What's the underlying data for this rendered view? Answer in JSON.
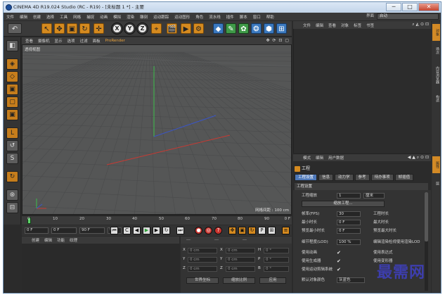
{
  "window": {
    "title": "CINEMA 4D R19.024 Studio (RC - R19) - [未标题 1 *] - 主要",
    "minimize": "─",
    "maximize": "□",
    "close": "✕"
  },
  "menubar": {
    "items": [
      "文件",
      "编辑",
      "创建",
      "选择",
      "工具",
      "网格",
      "捕捉",
      "动画",
      "模拟",
      "渲染",
      "雕刻",
      "运动跟踪",
      "运动图形",
      "角色",
      "流水线",
      "插件",
      "脚本",
      "窗口",
      "帮助"
    ],
    "layout_label": "界面",
    "layout_value": "启动"
  },
  "toolbar": {
    "undo": "↶",
    "tools": [
      "↖",
      "✥",
      "▣",
      "↻",
      "✛"
    ],
    "axes": [
      "X",
      "Y",
      "Z"
    ],
    "coord": "⌖",
    "render": [
      "🎬",
      "▶",
      "⚙"
    ],
    "create": [
      "◆",
      "✎",
      "✿",
      "❂",
      "⬢",
      "⊞"
    ]
  },
  "left_tools": [
    "◧",
    "◈",
    "◇",
    "▣",
    "▢",
    "▣",
    "L",
    "↺",
    "S",
    "↻",
    "⊛",
    "⊟"
  ],
  "viewport": {
    "menu": [
      "查看",
      "摄像机",
      "显示",
      "选项",
      "过滤",
      "面板"
    ],
    "render_menu": "ProRender",
    "label": "透视视图",
    "grid_spacing": "网格间距 : 100 cm",
    "nav_icons": "✥ ⟳ ⊡ ▢"
  },
  "timeline": {
    "ticks": [
      "0",
      "10",
      "20",
      "30",
      "40",
      "50",
      "60",
      "70",
      "80",
      "90"
    ],
    "end": "0 F"
  },
  "transport": {
    "current": "0 F",
    "start": "0 F",
    "end": "90 F",
    "end2": "90 F"
  },
  "materials": {
    "menu": [
      "创建",
      "编辑",
      "功能",
      "纹理"
    ]
  },
  "coordinates": {
    "headers": [
      "---",
      "---",
      "---"
    ],
    "rows": [
      {
        "axis": "X",
        "pos": "0 cm",
        "size": "0 cm",
        "rot_axis": "H",
        "rot": "0 °"
      },
      {
        "axis": "Y",
        "pos": "0 cm",
        "size": "0 cm",
        "rot_axis": "P",
        "rot": "0 °"
      },
      {
        "axis": "Z",
        "pos": "0 cm",
        "size": "0 cm",
        "rot_axis": "B",
        "rot": "0 °"
      }
    ],
    "mode1": "世界坐标",
    "mode2": "缩放比例",
    "apply": "应用"
  },
  "objects": {
    "menu": [
      "文件",
      "编辑",
      "查看",
      "对象",
      "标签",
      "书签"
    ]
  },
  "side_tabs": [
    "对象",
    "场次",
    "内容浏览器",
    "构造",
    "层"
  ],
  "attributes": {
    "menu": [
      "模式",
      "编辑",
      "用户数据"
    ],
    "title": "工程",
    "tabs": [
      "工程设置",
      "信息",
      "动力学",
      "参考",
      "待办事项",
      "帧插值"
    ],
    "section": "工程设置",
    "project_scale_label": "工程缩放",
    "project_scale_value": "1",
    "project_scale_unit": "厘米",
    "scale_button": "缩放工程...",
    "fps_label": "帧率(FPS)",
    "fps_value": "30",
    "min_time_label": "最小时长",
    "min_time_value": "0 F",
    "preview_min_label": "预览最小时长",
    "preview_min_value": "0 F",
    "project_time_label": "工程时长",
    "max_time_label": "最大时长",
    "preview_max_label": "预览最大时长",
    "lod_label": "细节程度(LOD)",
    "lod_value": "100 %",
    "render_lod_label": "编辑渲染检视使用渲染LOD",
    "use_anim_label": "使用动画",
    "use_expr_label": "使用表达式",
    "use_gen_label": "使用生成器",
    "use_deform_label": "使用变形器",
    "use_motion_label": "使用运动剪辑系统",
    "default_color_label": "默认对象颜色",
    "default_color_value": "灰蓝色"
  },
  "watermark": "最需网"
}
